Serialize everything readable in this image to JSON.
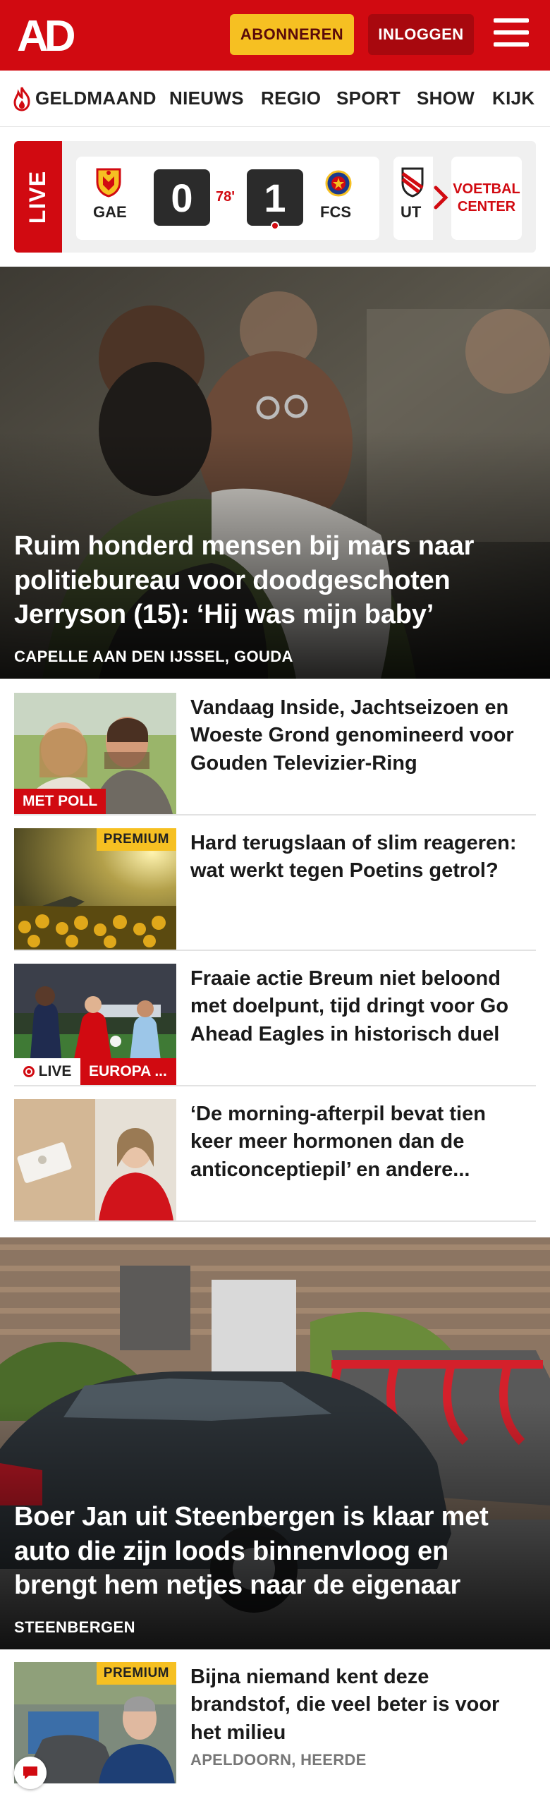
{
  "header": {
    "logo_text": "AD",
    "subscribe_label": "ABONNEREN",
    "login_label": "INLOGGEN",
    "menu_icon": "hamburger-menu-icon",
    "brand_color": "#d10a11",
    "accent_color": "#f6c022"
  },
  "nav": {
    "items": [
      {
        "label": "GELDMAAND",
        "icon": "flame-icon"
      },
      {
        "label": "NIEUWS"
      },
      {
        "label": "REGIO"
      },
      {
        "label": "SPORT"
      },
      {
        "label": "SHOW"
      },
      {
        "label": "KIJK"
      }
    ]
  },
  "live": {
    "badge": "LIVE",
    "match": {
      "home_code": "GAE",
      "home_score": "0",
      "minute": "78'",
      "away_score": "1",
      "away_code": "FCS"
    },
    "next_match_code": "UT",
    "voetbal_center_line1": "VOETBAL",
    "voetbal_center_line2": "CENTER"
  },
  "hero1": {
    "title": "Ruim honderd mensen bij mars naar politiebureau voor doodgeschoten Jerryson (15): ‘Hij was mijn baby’",
    "location": "CAPELLE AAN DEN IJSSEL, GOUDA"
  },
  "articles1": [
    {
      "title": "Vandaag Inside, Jachtseizoen en Woeste Grond genomineerd voor Gouden Televizier-Ring",
      "tag": "MET POLL"
    },
    {
      "title": "Hard terugslaan of slim reageren: wat werkt tegen Poetins getrol?",
      "premium": "PREMIUM"
    },
    {
      "title": "Fraaie actie Breum niet beloond met doelpunt, tijd dringt voor Go Ahead Eagles in historisch duel",
      "live": "LIVE",
      "tag": "EUROPA ..."
    },
    {
      "title": "‘De morning-afterpil bevat tien keer meer hormonen dan de anticonceptiepil’ en andere..."
    }
  ],
  "hero2": {
    "title": "Boer Jan uit Steenbergen is klaar met auto die zijn loods binnenvloog en brengt hem netjes naar de eigenaar",
    "location": "STEENBERGEN"
  },
  "articles2": [
    {
      "title": "Bijna niemand kent deze brandstof, die veel beter is voor het milieu",
      "meta": "APELDOORN, HEERDE",
      "premium": "PREMIUM"
    }
  ]
}
